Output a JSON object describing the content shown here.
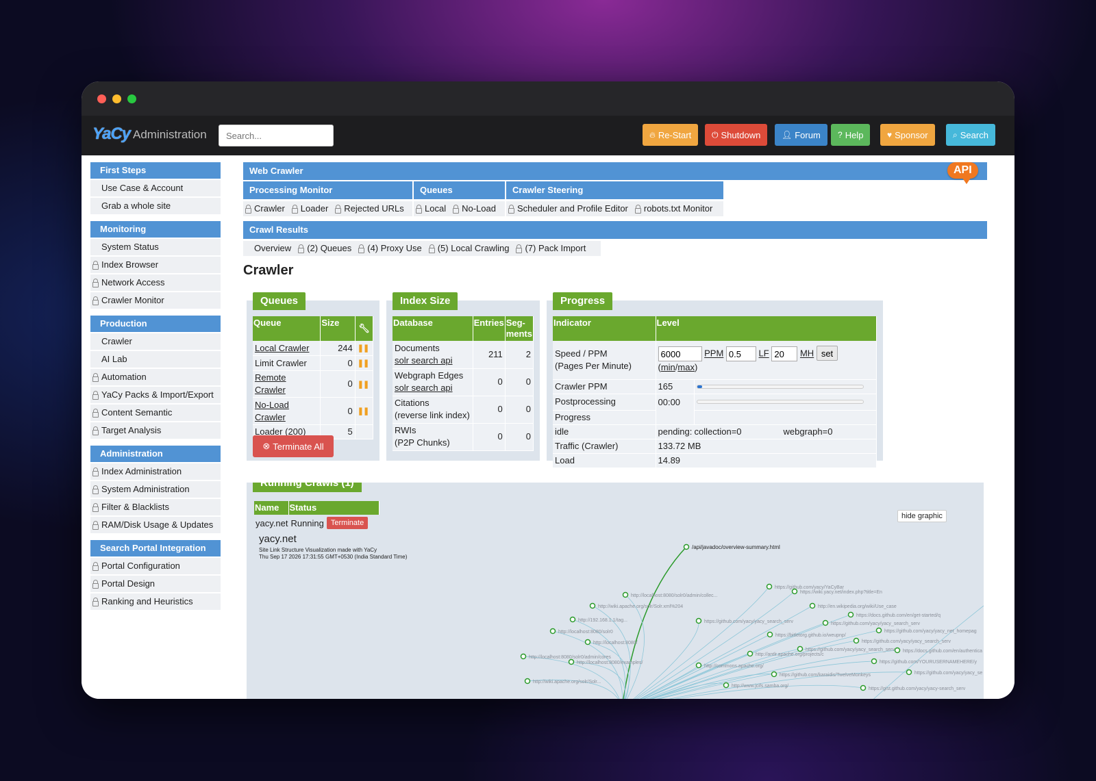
{
  "navbar": {
    "logo": "YaCy",
    "title": "Administration",
    "search_placeholder": "Search...",
    "buttons": {
      "restart": "Re-Start",
      "shutdown": "Shutdown",
      "forum": "Forum",
      "help": "Help",
      "sponsor": "Sponsor",
      "search": "Search"
    }
  },
  "sidebar": {
    "first_steps": {
      "title": "First Steps",
      "items": [
        "Use Case & Account",
        "Grab a whole site"
      ]
    },
    "monitoring": {
      "title": "Monitoring",
      "items": [
        "System Status",
        "Index Browser",
        "Network Access",
        "Crawler Monitor"
      ]
    },
    "production": {
      "title": "Production",
      "items": [
        "Crawler",
        "AI Lab",
        "Automation",
        "YaCy Packs & Import/Export",
        "Content Semantic",
        "Target Analysis"
      ]
    },
    "administration": {
      "title": "Administration",
      "items": [
        "Index Administration",
        "System Administration",
        "Filter & Blacklists",
        "RAM/Disk Usage & Updates"
      ]
    },
    "search_portal": {
      "title": "Search Portal Integration",
      "items": [
        "Portal Configuration",
        "Portal Design",
        "Ranking and Heuristics"
      ]
    }
  },
  "menu": {
    "web_crawler": "Web Crawler",
    "api_badge": "API",
    "processing_monitor": "Processing Monitor",
    "queues": "Queues",
    "crawler_steering": "Crawler Steering",
    "sub1": [
      "Crawler",
      "Loader",
      "Rejected URLs"
    ],
    "sub2": [
      "Local",
      "No-Load"
    ],
    "sub3": [
      "Scheduler and Profile Editor",
      "robots.txt Monitor"
    ],
    "crawl_results": "Crawl Results",
    "results_tabs": [
      "Overview",
      "(2) Queues",
      "(4) Proxy Use",
      "(5) Local Crawling",
      "(7) Pack Import"
    ]
  },
  "page_title": "Crawler",
  "queues_panel": {
    "title": "Queues",
    "headers": {
      "queue": "Queue",
      "size": "Size"
    },
    "rows": [
      {
        "name": "Local Crawler",
        "size": "244"
      },
      {
        "name": "Limit Crawler",
        "size": "0"
      },
      {
        "name": "Remote Crawler",
        "size": "0"
      },
      {
        "name": "No-Load Crawler",
        "size": "0"
      },
      {
        "name": "Loader",
        "extra": "(200)",
        "size": "5"
      }
    ],
    "terminate_all": "Terminate All"
  },
  "index_panel": {
    "title": "Index Size",
    "headers": {
      "database": "Database",
      "entries": "Entries",
      "segments": "Seg-ments"
    },
    "rows": [
      {
        "name": "Documents",
        "sub": "solr search api",
        "entries": "211",
        "segments": "2"
      },
      {
        "name": "Webgraph Edges",
        "sub": "solr search api",
        "entries": "0",
        "segments": "0"
      },
      {
        "name": "Citations",
        "sub": "(reverse link index)",
        "entries": "0",
        "segments": "0"
      },
      {
        "name": "RWIs",
        "sub": "(P2P Chunks)",
        "entries": "0",
        "segments": "0"
      }
    ]
  },
  "progress_panel": {
    "title": "Progress",
    "headers": {
      "indicator": "Indicator",
      "level": "Level"
    },
    "speed_label": "Speed / PPM",
    "speed_sub": "(Pages Per Minute)",
    "ppm_value": "6000",
    "ppm_label": "PPM",
    "lf_value": "0.5",
    "lf_label": "LF",
    "mh_value": "20",
    "mh_label": "MH",
    "set_label": "set",
    "min": "min",
    "max": "max",
    "crawler_ppm_label": "Crawler PPM",
    "crawler_ppm_value": "165",
    "crawler_ppm_fraction": 0.03,
    "post_label": "Postprocessing",
    "post_label2": "Progress",
    "post_value": "00:00",
    "post_fraction": 0,
    "idle_label": "idle",
    "pending_label": "pending:",
    "collection": "collection=0",
    "webgraph": "webgraph=0",
    "traffic_label": "Traffic (Crawler)",
    "traffic_value": "133.72 MB",
    "load_label": "Load",
    "load_value": "14.89"
  },
  "running_panel": {
    "title": "Running Crawls (1)",
    "headers": {
      "name": "Name",
      "status": "Status"
    },
    "row": {
      "name": "yacy.net",
      "status": "Running",
      "terminate": "Terminate"
    },
    "hide_graphic": "hide graphic",
    "graph_title": "yacy.net",
    "graph_subtitle": "Site Link Structure Visualization made with YaCy",
    "graph_date": "Thu Sep 17 2026 17:31:55 GMT+0530 (India Standard Time)",
    "graph_labels": [
      "/api/javadoc/overview-summary.html",
      "http://localhost:8080/solr0/admin/collec...",
      "http://wiki.apache.org/solr/Solr.xml%204",
      "http://192.168.1.1/tag...",
      "http://localhost:8080/solr0",
      "http://localhost:8080/",
      "http://localhost:8080/solr0/admin/cores",
      "http://localhost:8080/examples/",
      "http://wiki.apache.org/solr/Solr...",
      "https://github.com/yacy/YaCyBar",
      "https://wiki.yacy.net/index.php?title=En",
      "http://en.wikipedia.org/wiki/Use_case",
      "https://docs.github.com/en/get-started/q",
      "https://github.com/yacy/yacy_search_serv",
      "https://github.com/yacy/yacy_net_homepag",
      "https://github.com/yacy/yacy_search_serv",
      "https://docs.github.com/en/authentica",
      "https://github.com/YOURUSERNAMEHERE/y",
      "https://github.com/yacy/yacy_se",
      "https://bitletorg.github.io/weupnp/",
      "https://github.com/yacy/yacy_search_serv",
      "https://github.com/yacy/yacy_search_serv",
      "https://gist.github.com/yacy/yacy-search_serv",
      "http://antlr.apache.org/projects/c",
      "http://commons.apache.org/",
      "https://github.com/karaidis/TwelveMonkeys",
      "http://www.jcifs.samba.org/"
    ]
  },
  "colors": {
    "blue_header": "#5193d4",
    "green_header": "#6aa82e",
    "restart": "#f0a640",
    "shutdown": "#dd4b39",
    "forum": "#3b84c8",
    "help": "#5cb85c",
    "sponsor": "#f0a640",
    "search": "#46b8da",
    "api": "#f07820"
  }
}
